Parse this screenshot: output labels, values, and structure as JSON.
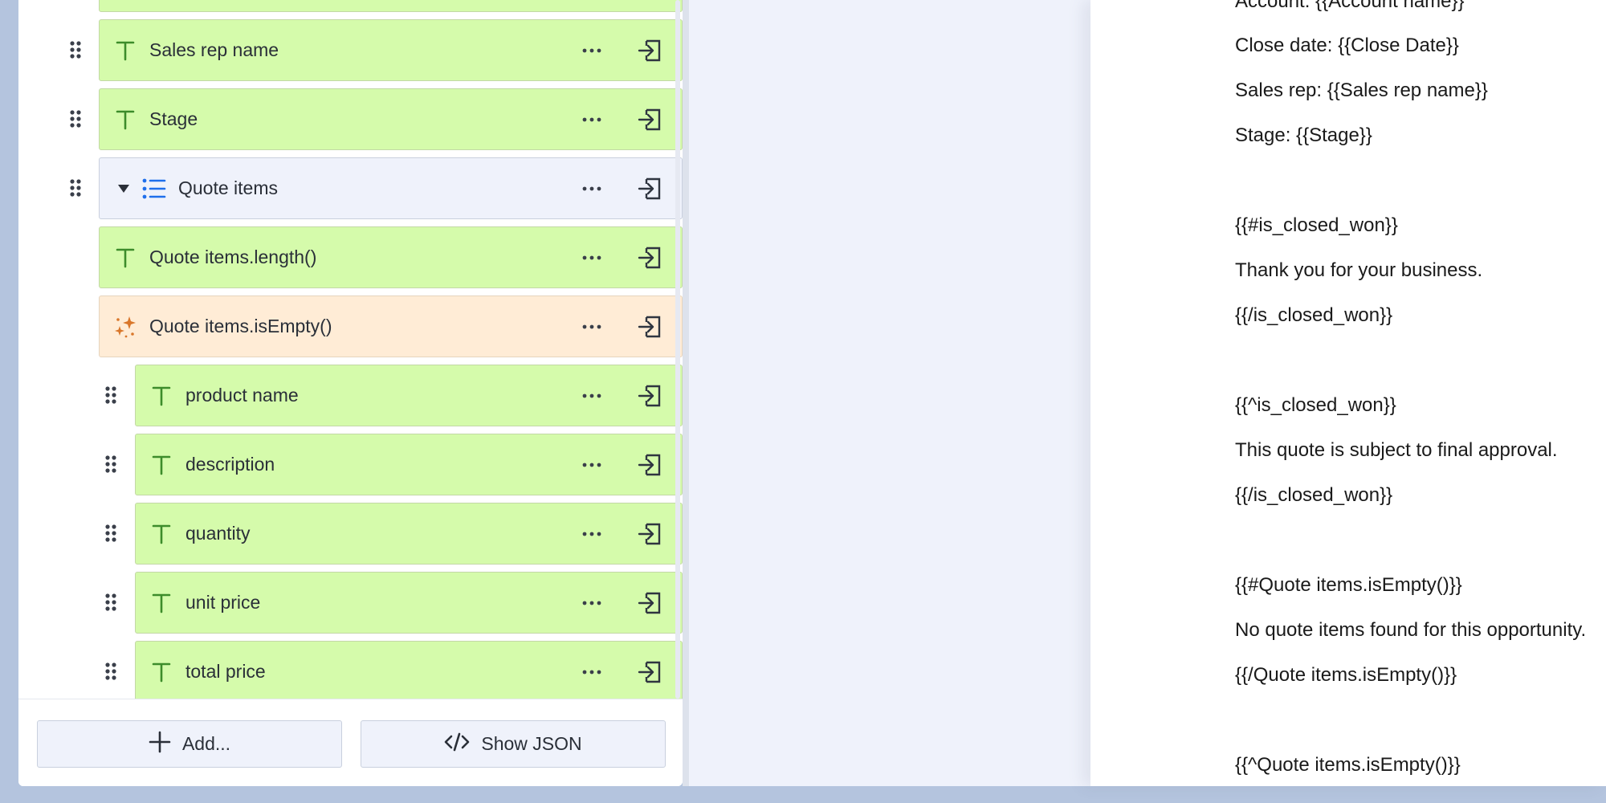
{
  "fields": [
    {
      "label": "",
      "kind": "text"
    },
    {
      "label": "Sales rep name",
      "kind": "text"
    },
    {
      "label": "Stage",
      "kind": "text"
    },
    {
      "label": "Quote items",
      "kind": "list"
    },
    {
      "label": "Quote items.length()",
      "kind": "text"
    },
    {
      "label": "Quote items.isEmpty()",
      "kind": "computed"
    },
    {
      "label": "product name",
      "kind": "text"
    },
    {
      "label": "description",
      "kind": "text"
    },
    {
      "label": "quantity",
      "kind": "text"
    },
    {
      "label": "unit price",
      "kind": "text"
    },
    {
      "label": "total price",
      "kind": "text"
    }
  ],
  "buttons": {
    "add_label": "Add...",
    "show_json_label": "Show JSON"
  },
  "document": {
    "lines": [
      "Account: {{Account name}}",
      "Close date: {{Close Date}}",
      "Sales rep: {{Sales rep name}}",
      "Stage: {{Stage}}",
      "{{#is_closed_won}}",
      "Thank you for your business.",
      "{{/is_closed_won}}",
      "{{^is_closed_won}}",
      "This quote is subject to final approval.",
      "{{/is_closed_won}}",
      "{{#Quote items.isEmpty()}}",
      "No quote items found for this opportunity.",
      "{{/Quote items.isEmpty()}}",
      "{{^Quote items.isEmpty()}}"
    ]
  },
  "colors": {
    "text_field_bg": "#d5fbab",
    "list_field_bg": "#eff2fb",
    "computed_field_bg": "#ffecd6",
    "text_icon": "#3d8c2b",
    "list_icon": "#1f6feb",
    "computed_icon": "#d9772b"
  },
  "icons": {
    "text_field": "text-type-icon",
    "list_field": "list-icon",
    "computed_field": "sparkles-icon",
    "more": "more-horizontal-icon",
    "insert": "insert-field-icon",
    "drag": "drag-handle-icon",
    "add": "plus-icon",
    "json": "code-icon",
    "expand": "caret-down-icon"
  }
}
